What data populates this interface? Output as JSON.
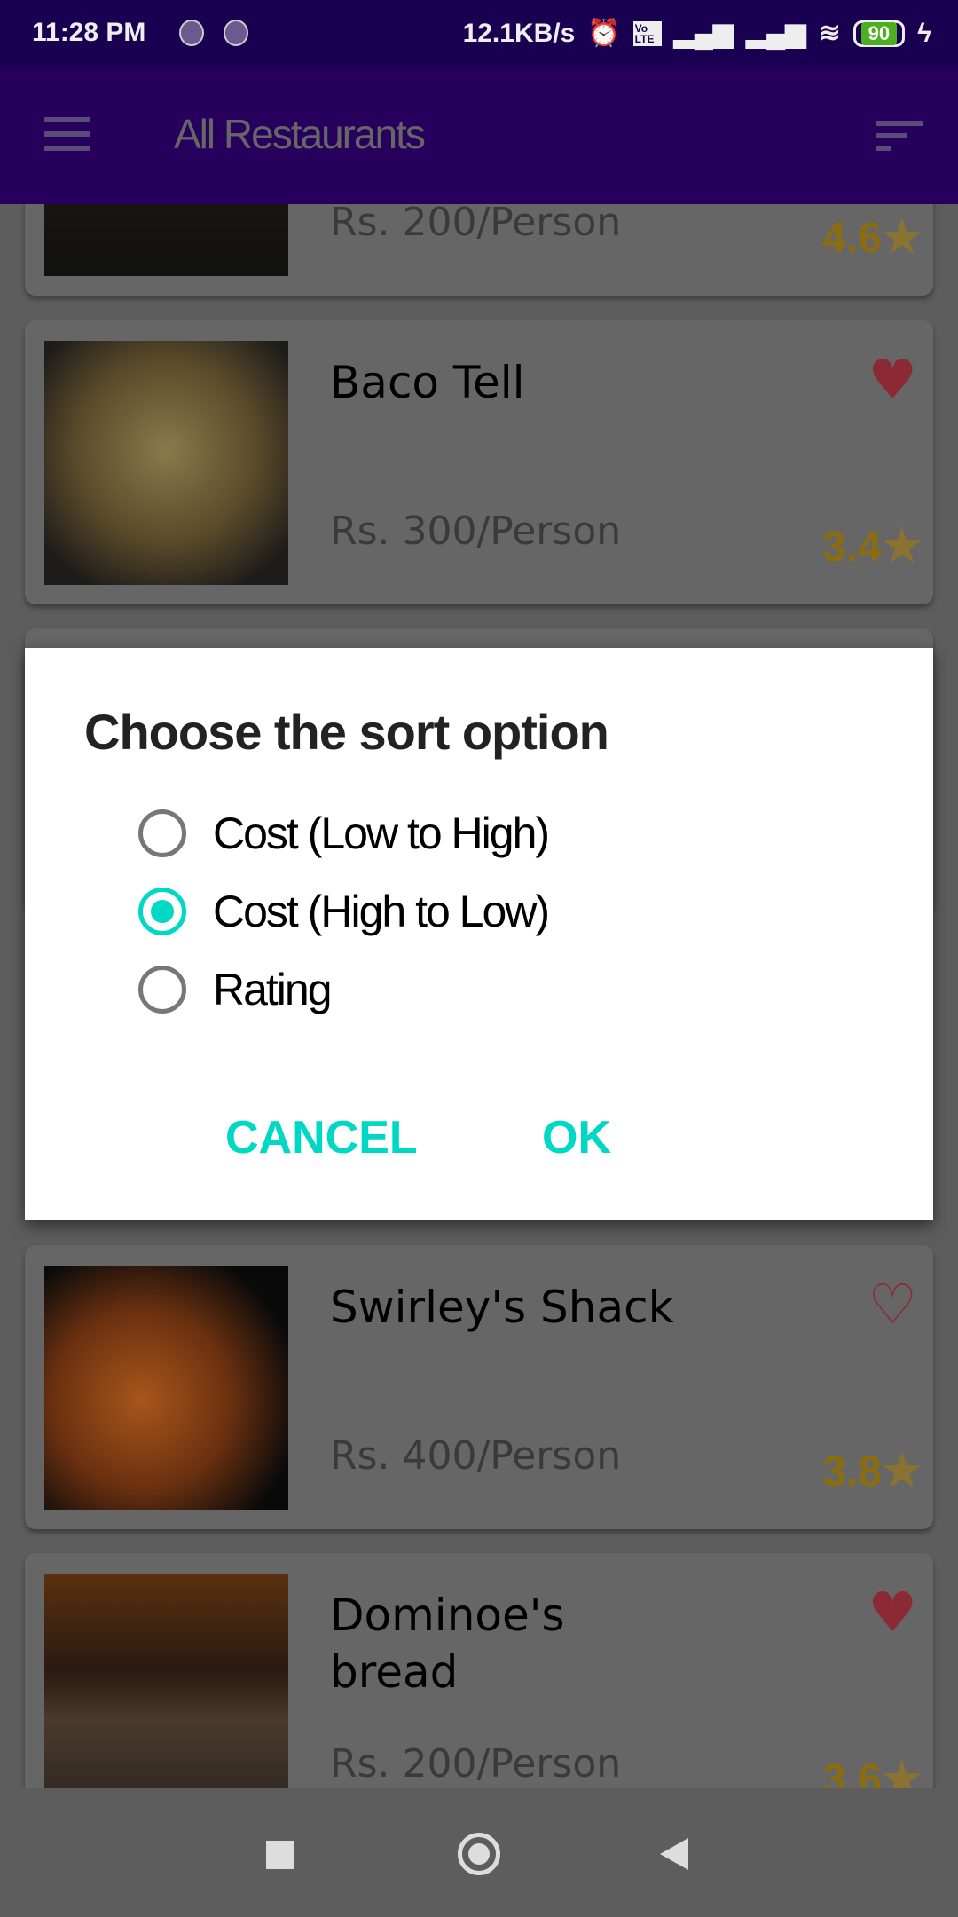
{
  "status_bar": {
    "time": "11:28 PM",
    "net_speed": "12.1KB/s",
    "volte": "Vo LTE",
    "battery": "90"
  },
  "app_bar": {
    "title": "All Restaurants"
  },
  "restaurants": [
    {
      "name": "",
      "price": "Rs. 200/Person",
      "rating": "4.6",
      "favorite": false
    },
    {
      "name": "Baco Tell",
      "price": "Rs. 300/Person",
      "rating": "3.4",
      "favorite": true
    },
    {
      "name": "Swirley's Shack",
      "price": "Rs. 400/Person",
      "rating": "3.8",
      "favorite": false
    },
    {
      "name": "Dominoe's bread",
      "price": "Rs. 200/Person",
      "rating": "3.6",
      "favorite": true
    }
  ],
  "dialog": {
    "title": "Choose the sort option",
    "options": [
      "Cost (Low to High)",
      "Cost (High to Low)",
      "Rating"
    ],
    "selected": 1,
    "cancel": "CANCEL",
    "ok": "OK"
  },
  "colors": {
    "accent": "#00d8c6",
    "appbar": "#27005e",
    "status": "#1a0050"
  }
}
